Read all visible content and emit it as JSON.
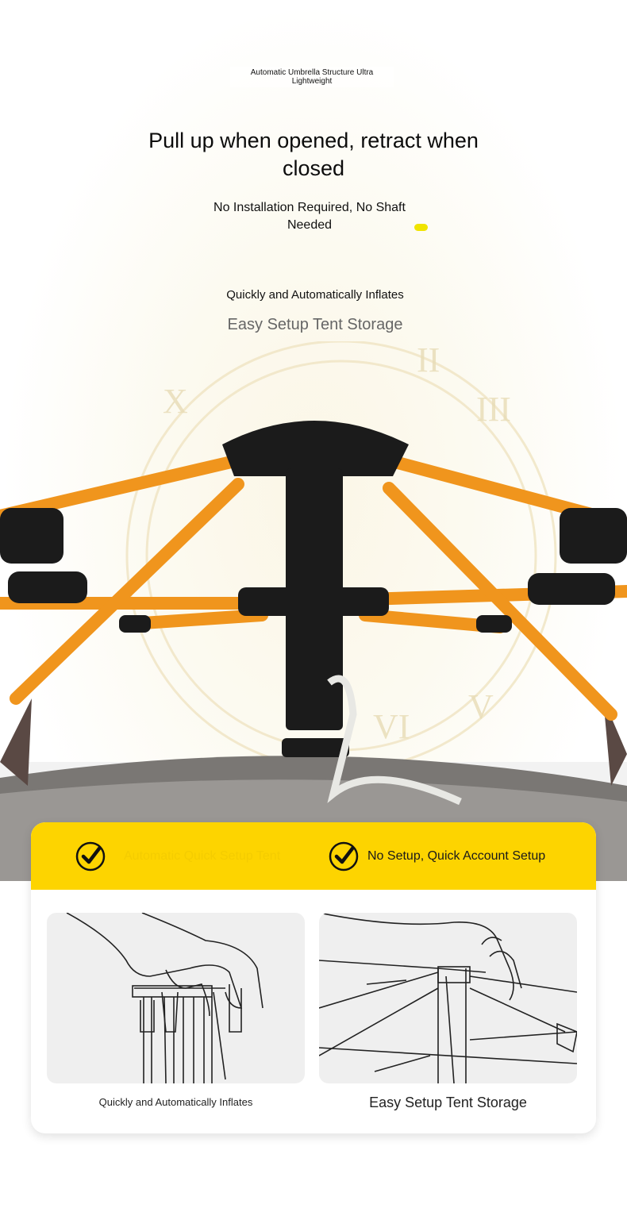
{
  "header": {
    "tagline": "Automatic Umbrella Structure Ultra Lightweight",
    "headline": "Pull up when opened, retract when closed",
    "subline": "No Installation Required, No Shaft Needed",
    "accent_dot_color": "#f0e400"
  },
  "mid": {
    "line1": "Quickly and Automatically Inflates",
    "line2": "Easy Setup Tent Storage"
  },
  "features": {
    "band_color": "#fdd400",
    "items": [
      {
        "icon": "check-circle-icon",
        "label": "Automatic Quick Setup Tent"
      },
      {
        "icon": "check-circle-icon",
        "label": "No Setup, Quick Account Setup"
      }
    ]
  },
  "illustrations": [
    {
      "icon": "hand-pulling-frame-icon",
      "caption": "Quickly and Automatically Inflates"
    },
    {
      "icon": "hand-pressing-hub-icon",
      "caption": "Easy Setup Tent Storage"
    }
  ]
}
